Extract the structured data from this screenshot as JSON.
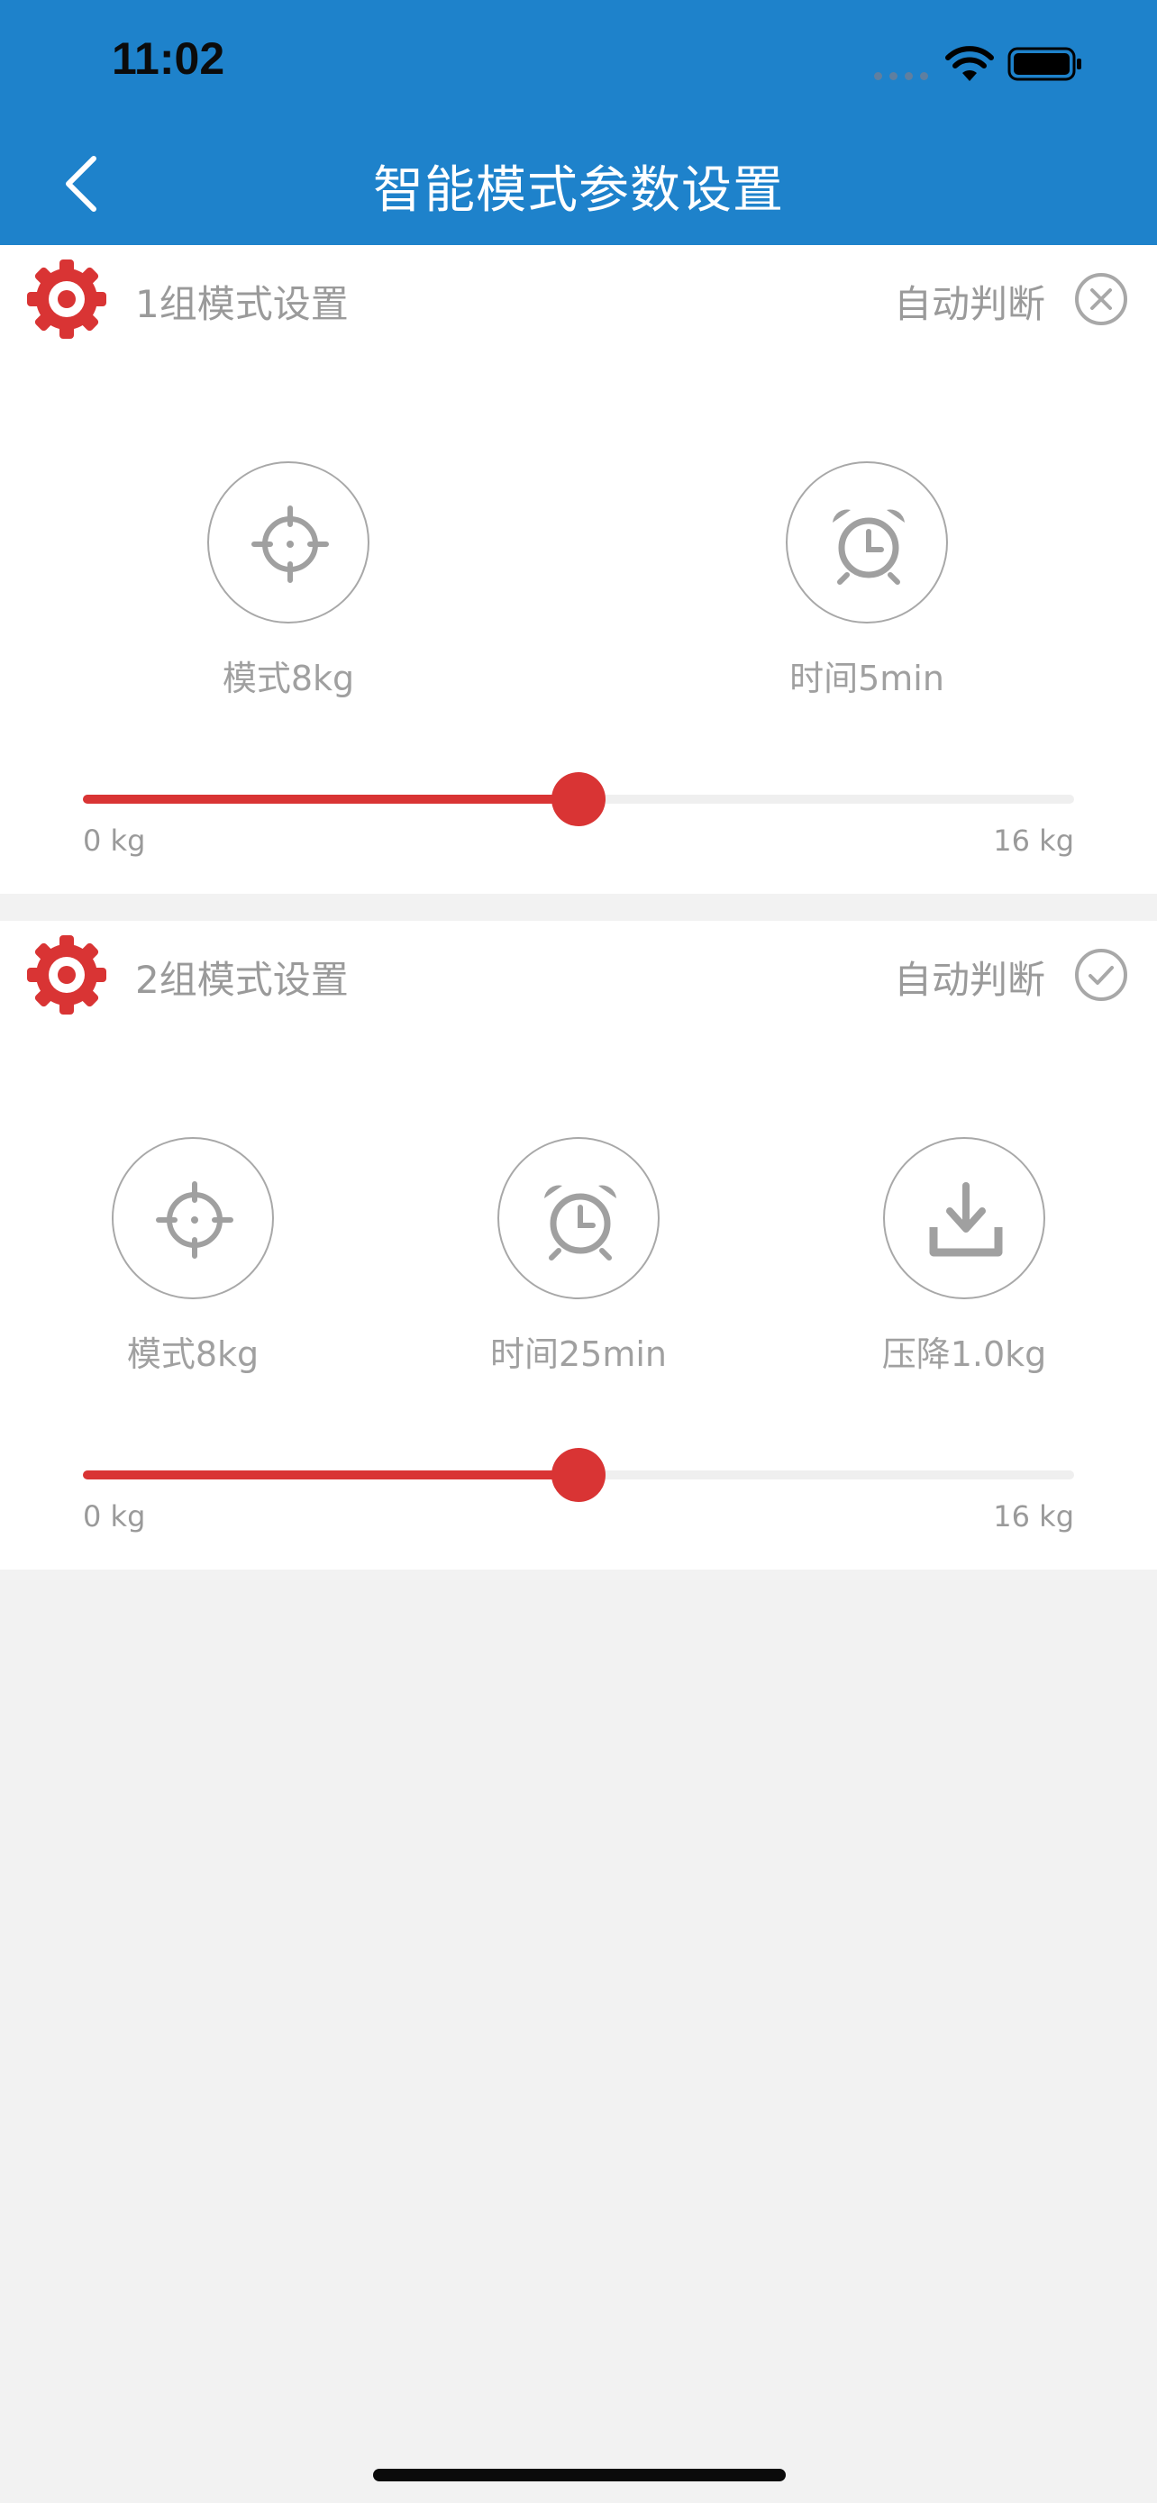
{
  "status_bar": {
    "time": "11:02"
  },
  "header": {
    "title": "智能模式参数设置",
    "back_icon": "chevron-left-icon"
  },
  "colors": {
    "header_bg": "#1e82cb",
    "accent": "#d93434",
    "muted": "#9a9a9a"
  },
  "groups": [
    {
      "title": "1组模式设置",
      "auto_label": "自动判断",
      "status_icon": "close-circle-icon",
      "params": [
        {
          "icon": "crosshair-icon",
          "label": "模式8kg"
        },
        {
          "icon": "alarm-clock-icon",
          "label": "时间5min"
        }
      ],
      "slider": {
        "min_label": "0 kg",
        "max_label": "16 kg",
        "value_fraction": 0.5
      }
    },
    {
      "title": "2组模式设置",
      "auto_label": "自动判断",
      "status_icon": "check-circle-icon",
      "params": [
        {
          "icon": "crosshair-icon",
          "label": "模式8kg"
        },
        {
          "icon": "alarm-clock-icon",
          "label": "时间25min"
        },
        {
          "icon": "download-icon",
          "label": "压降1.0kg"
        }
      ],
      "slider": {
        "min_label": "0 kg",
        "max_label": "16 kg",
        "value_fraction": 0.5
      }
    }
  ]
}
